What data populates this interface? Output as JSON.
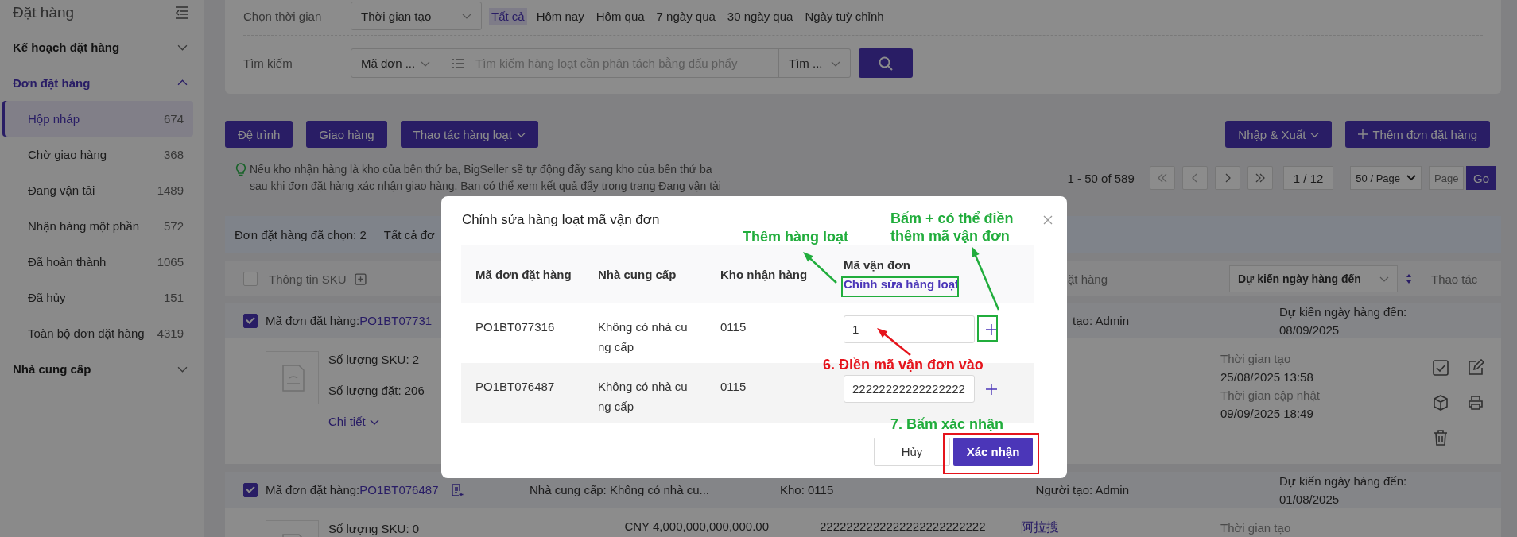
{
  "sidebar": {
    "title": "Đặt hàng",
    "groups": [
      {
        "label": "Kế hoạch đặt hàng",
        "expanded": false
      },
      {
        "label": "Đơn đặt hàng",
        "expanded": true,
        "items": [
          {
            "label": "Hộp nháp",
            "count": "674",
            "selected": true
          },
          {
            "label": "Chờ giao hàng",
            "count": "368",
            "selected": false
          },
          {
            "label": "Đang vận tải",
            "count": "1489",
            "selected": false
          },
          {
            "label": "Nhận hàng một phần",
            "count": "572",
            "selected": false
          },
          {
            "label": "Đã hoàn thành",
            "count": "1065",
            "selected": false
          },
          {
            "label": "Đã hủy",
            "count": "151",
            "selected": false
          },
          {
            "label": "Toàn bộ đơn đặt hàng",
            "count": "4319",
            "selected": false
          }
        ]
      },
      {
        "label": "Nhà cung cấp",
        "expanded": false
      }
    ]
  },
  "filters": {
    "time_label": "Chọn thời gian",
    "time_select": "Thời gian tạo",
    "time_options": [
      {
        "label": "Tất cả",
        "selected": true
      },
      {
        "label": "Hôm nay",
        "selected": false
      },
      {
        "label": "Hôm qua",
        "selected": false
      },
      {
        "label": "7 ngày qua",
        "selected": false
      },
      {
        "label": "30 ngày qua",
        "selected": false
      },
      {
        "label": "Ngày tuỳ chỉnh",
        "selected": false
      }
    ],
    "search_label": "Tìm kiếm",
    "search_field": "Mã đơn ...",
    "search_placeholder": "Tìm kiếm hàng loạt cần phân tách bằng dấu phẩy",
    "search_mode": "Tìm ..."
  },
  "toolbar": {
    "left": [
      {
        "label": "Đệ trình",
        "kind": "plain"
      },
      {
        "label": "Giao hàng",
        "kind": "plain"
      },
      {
        "label": "Thao tác hàng loạt",
        "kind": "dropdown"
      }
    ],
    "right": [
      {
        "label": "Nhập & Xuất",
        "kind": "dropdown"
      },
      {
        "label": "Thêm đơn đặt hàng",
        "kind": "add"
      }
    ]
  },
  "tip": "Nếu kho nhận hàng là kho của bên thứ ba, BigSeller sẽ tự động đẩy sang kho của bên thứ ba\nsau khi đơn đặt hàng xác nhận giao hàng. Bạn có thể xem kết quả đẩy trong trang Đang vận tải",
  "pagination": {
    "range": "1 - 50 of 589",
    "page": "1 / 12",
    "page_size": "50 / Page",
    "page_placeholder": "Page",
    "go": "Go"
  },
  "selection_bar": {
    "selected": "Đơn đặt hàng đã chọn: 2",
    "all": "Tất cả đơ"
  },
  "table": {
    "select_all_checked": false,
    "sku_column": "Thông tin SKU",
    "column_2": "ặt hàng",
    "sort_select": "Dự kiến ngày hàng đến",
    "actions_column": "Thao tác"
  },
  "orders": [
    {
      "checked": true,
      "order_label": "Mã đơn đặt hàng:",
      "order_no": "PO1BT07731",
      "creator": "tạo: Admin",
      "eta_label": "Dự kiến ngày hàng đến:",
      "eta": "08/09/2025",
      "sku_count": "Số lượng SKU: 2",
      "quantity": "Số lượng đặt: 206",
      "detail": "Chi tiết",
      "created_label": "Thời gian tạo",
      "created": "25/08/2025 13:58",
      "updated_label": "Thời gian cập nhật",
      "updated": "09/09/2025 18:49"
    },
    {
      "checked": true,
      "order_label": "Mã đơn đặt hàng:",
      "order_no": "PO1BT076487",
      "supplier": "Nhà cung cấp: Không có nhà cu...",
      "warehouse": "Kho: 0115",
      "creator": "Người tạo: Admin",
      "eta_label": "Dự kiến ngày hàng đến:",
      "eta": "01/08/2025",
      "sku_count": "Số lượng SKU: 0",
      "amount": "CNY 4,000,000,000,000.00",
      "tracking": "2222222222222222222222222",
      "creator_tag": "阿拉搜",
      "created_label": "Thời gian tạo"
    }
  ],
  "modal": {
    "title": "Chỉnh sửa hàng loạt mã vận đơn",
    "columns": [
      "Mã đơn đặt hàng",
      "Nhà cung cấp",
      "Kho nhận hàng",
      "Mã vận đơn"
    ],
    "bulk_edit_link": "Chỉnh sửa hàng loạt",
    "rows": [
      {
        "order_no": "PO1BT077316",
        "supplier": "Không có nhà cung cấp",
        "warehouse": "0115",
        "tracking": "1"
      },
      {
        "order_no": "PO1BT076487",
        "supplier": "Không có nhà cung cấp",
        "warehouse": "0115",
        "tracking": "22222222222222222"
      }
    ],
    "cancel": "Hủy",
    "confirm": "Xác nhận"
  },
  "annotations": [
    {
      "kind": "callout",
      "text": "Thêm hàng loạt",
      "color": "#21ad3c",
      "arrow": true
    },
    {
      "kind": "frame",
      "color": "#21ad3c"
    },
    {
      "kind": "callout",
      "text": "Bấm + có thể điền\nthêm mã vận đơn",
      "color": "#21ad3c",
      "arrow": true
    },
    {
      "kind": "frame",
      "color": "#21ad3c"
    },
    {
      "kind": "callout",
      "text": "6. Điền mã vận đơn vào",
      "color": "#e5141c",
      "arrow": true
    },
    {
      "kind": "callout",
      "text": "7. Bấm xác nhận",
      "color": "#21ad3c",
      "arrow": false
    },
    {
      "kind": "frame",
      "color": "#e5141c"
    }
  ]
}
